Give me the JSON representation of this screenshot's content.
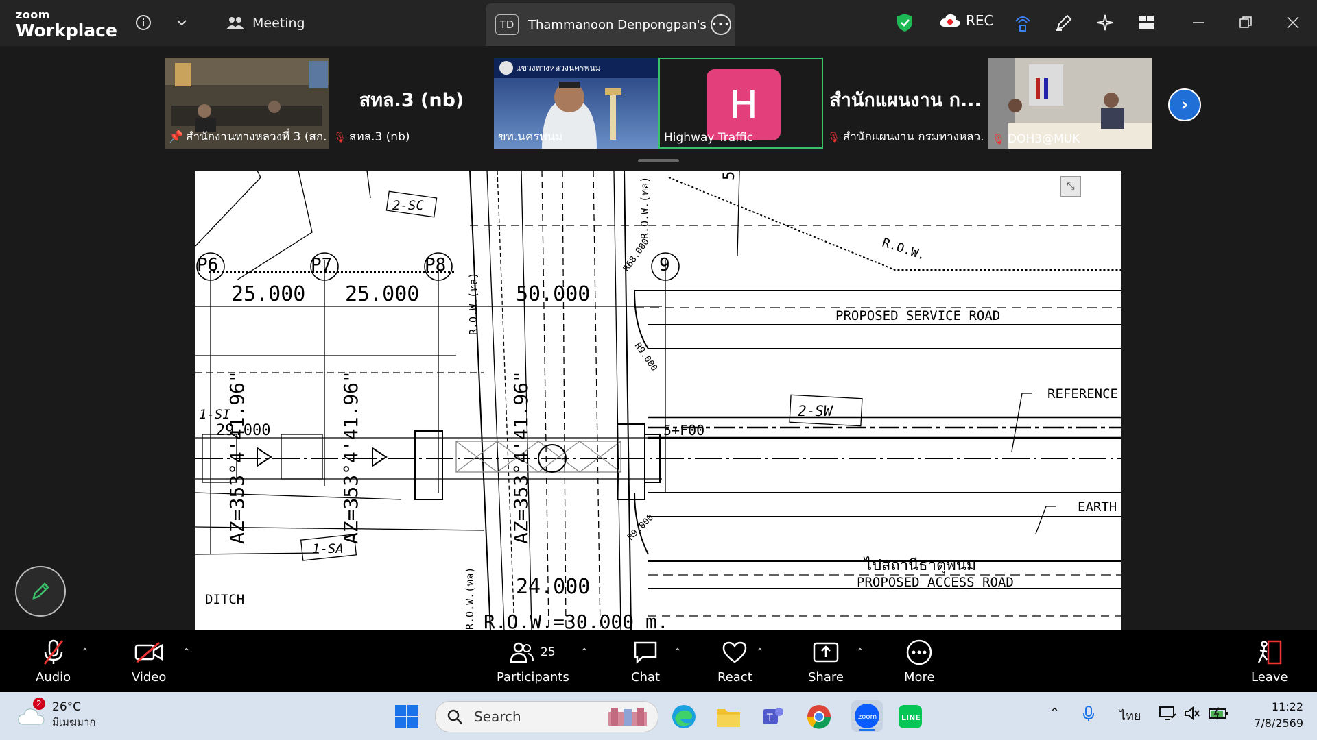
{
  "app": {
    "logo_small": "zoom",
    "logo_big": "Workplace",
    "meeting_label": "Meeting"
  },
  "share_tab": {
    "initials": "TD",
    "title": "Thammanoon Denpongpan's screen"
  },
  "recording": {
    "label": "REC"
  },
  "gallery": {
    "tiles": [
      {
        "label": "สำนักงานทางหลวงที่ 3 (สก...",
        "big": ""
      },
      {
        "label": "สทล.3 (nb)",
        "big": "สทล.3 (nb)"
      },
      {
        "label": "ขท.นครพนม",
        "big": "",
        "banner": "แขวงทางหลวงนครพนม"
      },
      {
        "label": "Highway Traffic",
        "big": "",
        "avatar": "H"
      },
      {
        "label": "สำนักแผนงาน กรมทางหลว...",
        "big": "สำนักแผนงาน ก..."
      },
      {
        "label": "DOH3@MUK",
        "big": ""
      }
    ]
  },
  "drawing": {
    "posts": [
      "P6",
      "P7",
      "P8",
      "9"
    ],
    "dims": [
      "25.000",
      "25.000",
      "50.000",
      "24.000",
      "29.000",
      "R.O.W.=30.000 m."
    ],
    "angles": [
      "AZ=353°4'41.96\"",
      "AZ=353°4'41.96\"",
      "AZ=353°4'41.96\""
    ],
    "labels": {
      "service_road": "PROPOSED SERVICE ROAD",
      "access_road": "PROPOSED ACCESS ROAD",
      "thai_dir": "ไปสถานีธาตุพนม",
      "reference": "REFERENCE",
      "earth": "EARTH",
      "ditch": "DITCH",
      "row": "R.O.W.",
      "row_thai": "R.O.W.(ทล)",
      "sw": "2-SW",
      "sc": "2-SC",
      "sa": "1-SA",
      "si": "1-SI",
      "r9a": "R9.000",
      "r9b": "R9.000",
      "r68": "R68.000",
      "sta": "5+F00",
      "five": "5"
    }
  },
  "toolbar": {
    "audio": "Audio",
    "video": "Video",
    "participants": "Participants",
    "participants_count": "25",
    "chat": "Chat",
    "react": "React",
    "share": "Share",
    "more": "More",
    "leave": "Leave"
  },
  "taskbar": {
    "weather_badge": "2",
    "temp": "26°C",
    "weather_desc": "มีเมฆมาก",
    "search_placeholder": "Search",
    "lang": "ไทย",
    "time": "11:22",
    "date": "7/8/2569"
  }
}
